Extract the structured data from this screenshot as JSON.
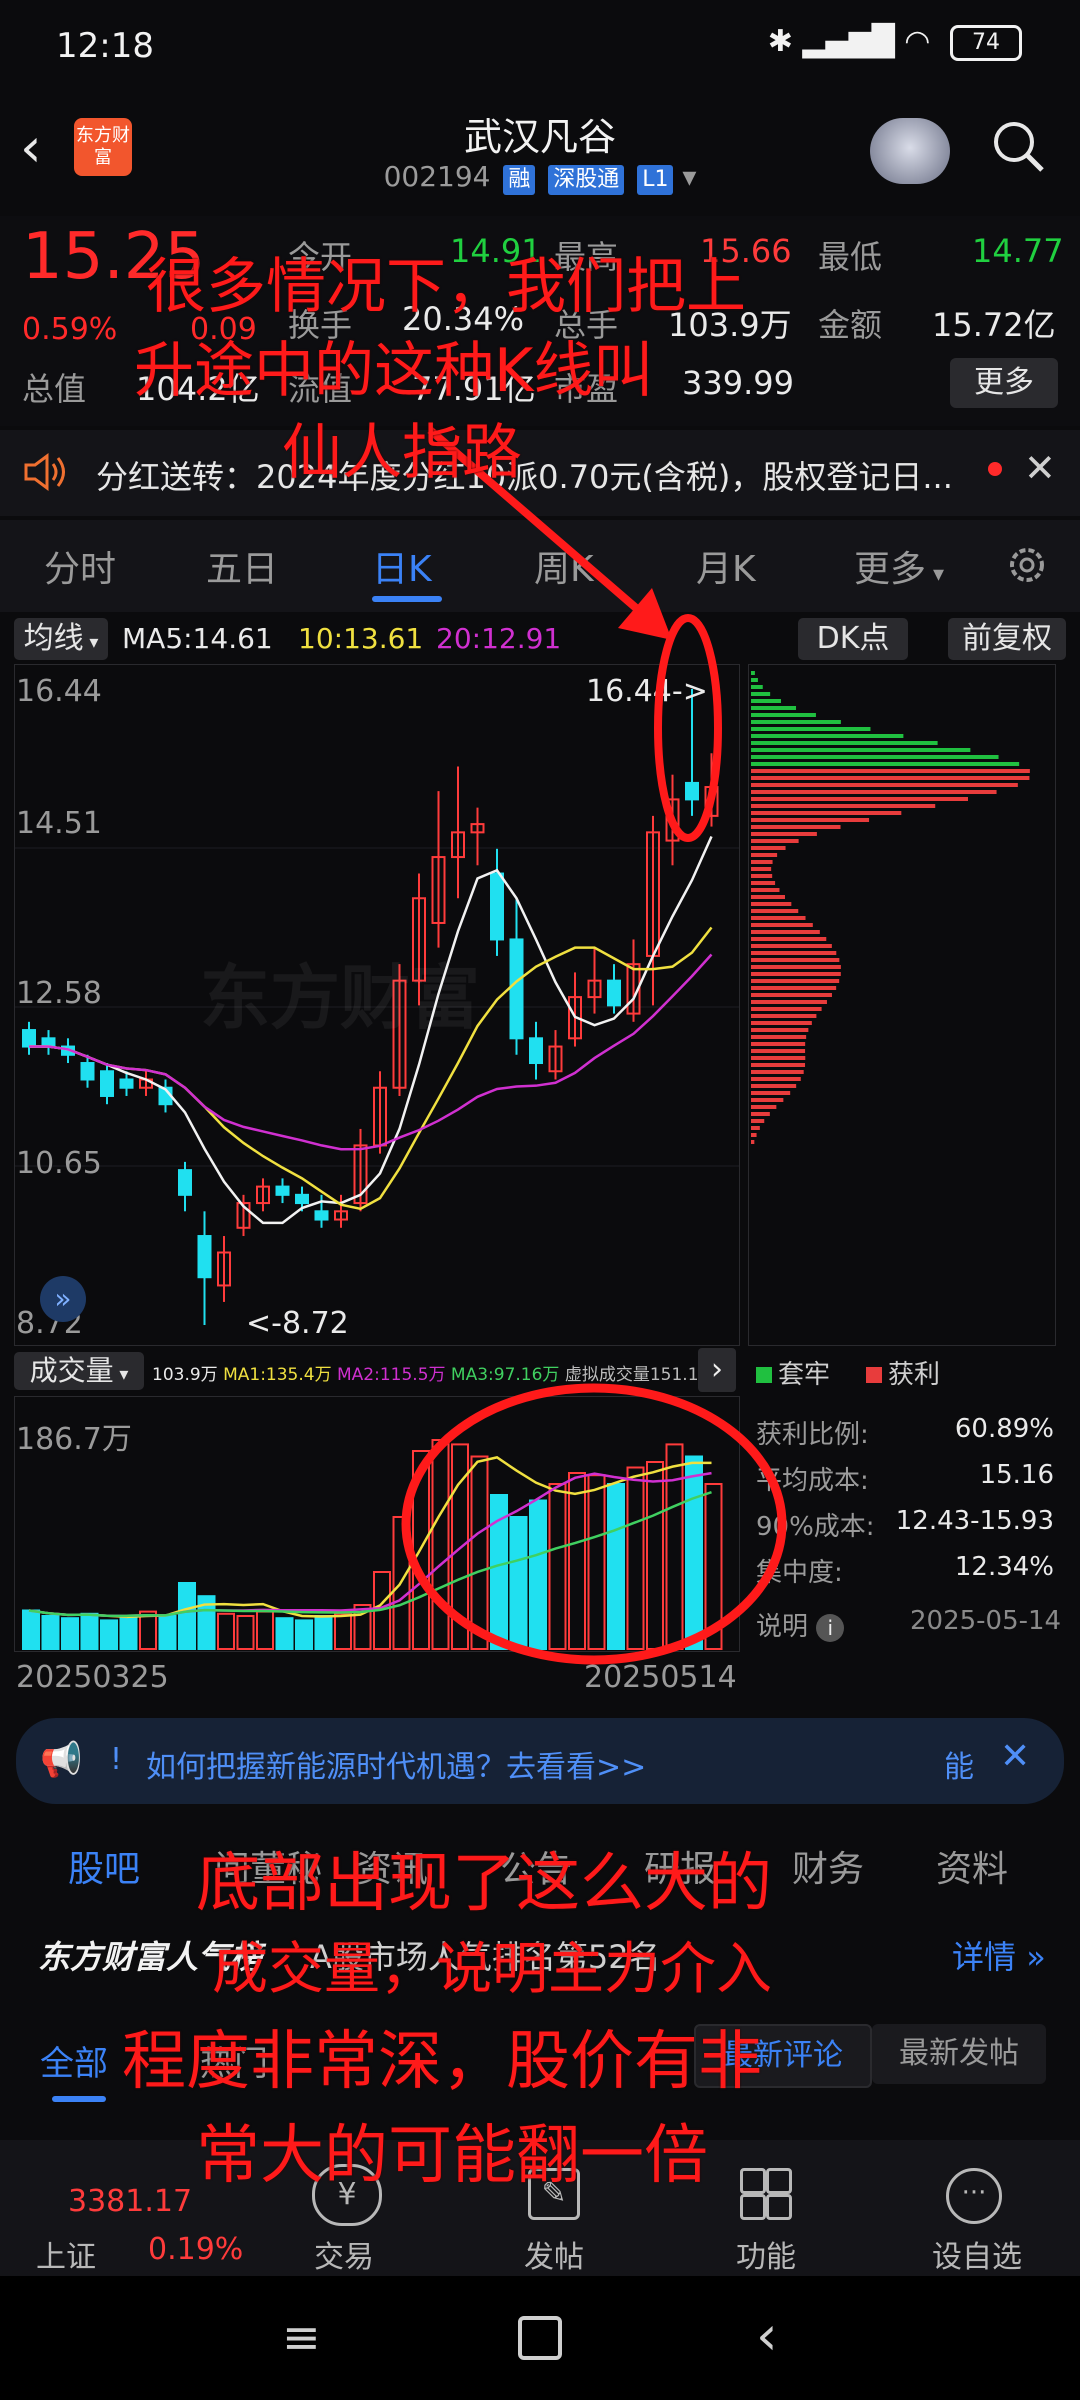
{
  "status": {
    "time": "12:18",
    "battery": "74"
  },
  "header": {
    "title": "武汉凡谷",
    "code": "002194",
    "tags": [
      "融",
      "深股通",
      "L1"
    ],
    "logo_text": "东方财富"
  },
  "quote": {
    "price": "15.25",
    "change_pct": "0.59%",
    "change": "0.09",
    "today_open_label": "今开",
    "today_open": "14.91",
    "high_label": "最高",
    "high": "15.66",
    "low_label": "最低",
    "low": "14.77",
    "turnover_label": "换手",
    "turnover": "20.34%",
    "volume_label": "总手",
    "volume": "103.9万",
    "amount_label": "金额",
    "amount": "15.72亿",
    "total_mv_label": "总值",
    "total_mv": "104.2亿",
    "float_mv_label": "流值",
    "float_mv": "77.91亿",
    "pe_label": "市盈",
    "pe": "339.99",
    "more_button": "更多"
  },
  "notice": {
    "text": "分红送转：2024年度分红10派0.70元(含税)，股权登记日..."
  },
  "tabs": [
    "分时",
    "五日",
    "日K",
    "周K",
    "月K",
    "更多"
  ],
  "active_tab": "日K",
  "ma": {
    "selector": "均线",
    "ma5": "MA5:14.61",
    "ma10": "10:13.61",
    "ma20": "20:12.91",
    "dk_button": "DK点",
    "fq_button": "前复权"
  },
  "kline": {
    "y_ticks": [
      "16.44",
      "14.51",
      "12.58",
      "10.65",
      "8.72"
    ],
    "high_marker": "16.44->",
    "low_marker": "<-8.72",
    "watermark": "东方财富"
  },
  "volume": {
    "selector": "成交量",
    "legend": [
      "103.9万",
      "MA1:135.4万",
      "MA2:115.5万",
      "MA3:97.16万",
      "虚拟成交量151.1万"
    ],
    "y_top": "186.7万",
    "start_date": "20250325",
    "end_date": "20250514"
  },
  "chips": {
    "legend_trapped": "套牢",
    "legend_profit": "获利",
    "stats": [
      {
        "label": "获利比例:",
        "value": "60.89%"
      },
      {
        "label": "平均成本:",
        "value": "15.16"
      },
      {
        "label": "90%成本:",
        "value": "12.43-15.93"
      },
      {
        "label": "集中度:",
        "value": "12.34%"
      }
    ],
    "explain": "说明",
    "date": "2025-05-14"
  },
  "banner": {
    "text": "如何把握新能源时代机遇？去看看>>",
    "prefix": "!",
    "suffix": "能"
  },
  "bottom_tabs": [
    "股吧",
    "问董秘",
    "资讯",
    "公告",
    "研报",
    "财务",
    "资料"
  ],
  "guba": {
    "brand": "东方财富人气榜",
    "rank_text": "A股市场人气排名第52名",
    "details": "详情"
  },
  "filter_tabs": [
    "全部",
    "热门",
    "最新评论",
    "最新发帖"
  ],
  "index": {
    "name": "上证",
    "value": "3381.17",
    "pct": "0.19%"
  },
  "nav": [
    "交易",
    "发帖",
    "功能",
    "设自选"
  ],
  "annotations": {
    "top": [
      "很多情况下，我们把上",
      "升途中的这种K线叫",
      "仙人指路"
    ],
    "bottom": [
      "底部出现了这么大的",
      "成交量，说明主力介入",
      "程度非常深，股价有非",
      "常大的可能翻一倍"
    ]
  },
  "colors": {
    "up": "#ff3b3b",
    "down": "#20e0f0",
    "accent": "#3b82f6",
    "annotation": "#ff1a1a"
  }
}
